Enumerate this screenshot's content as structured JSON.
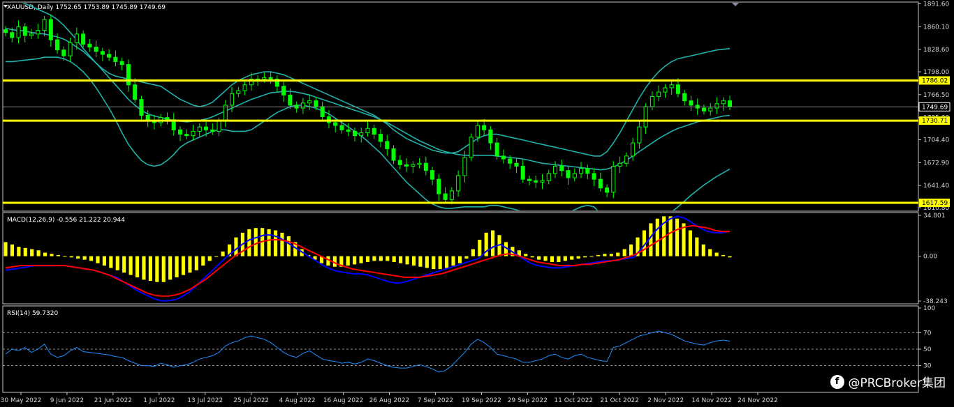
{
  "chart_data": [
    {
      "type": "candlestick",
      "symbol": "XAUUSD,,Daily",
      "ohlc": "1752.65 1753.89 1745.89 1749.69",
      "title": "XAUUSD,,Daily 1752.65 1753.89 1745.89 1749.69",
      "ylim": [
        1607,
        1893
      ],
      "y_ticks": [
        "1891.60",
        "1860.10",
        "1828.60",
        "1798.00",
        "1766.50",
        "1735.00",
        "1704.40",
        "1672.90",
        "1641.40",
        "1610.80"
      ],
      "y_tick_values": [
        1891.6,
        1860.1,
        1828.6,
        1798.0,
        1766.5,
        1735.0,
        1704.4,
        1672.9,
        1641.4,
        1610.8
      ],
      "horizontal_levels": [
        {
          "value": 1786.02,
          "label": "1786.02",
          "color": "#ffff00"
        },
        {
          "value": 1730.71,
          "label": "1730.71",
          "color": "#ffff00"
        },
        {
          "value": 1617.59,
          "label": "1617.59",
          "color": "#ffff00"
        }
      ],
      "price_line": {
        "value": 1749.69,
        "label": "1749.69"
      },
      "colors": {
        "candle": "#00ff00",
        "bollinger": "#20b2aa",
        "levels": "#ffff00"
      },
      "x_labels": [
        "30 May 2022",
        "9 Jun 2022",
        "21 Jun 2022",
        "1 Jul 2022",
        "13 Jul 2022",
        "25 Jul 2022",
        "4 Aug 2022",
        "16 Aug 2022",
        "26 Aug 2022",
        "7 Sep 2022",
        "19 Sep 2022",
        "29 Sep 2022",
        "11 Oct 2022",
        "21 Oct 2022",
        "2 Nov 2022",
        "14 Nov 2022",
        "24 Nov 2022"
      ],
      "close": [
        1852,
        1845,
        1860,
        1848,
        1850,
        1855,
        1870,
        1842,
        1828,
        1820,
        1838,
        1850,
        1836,
        1832,
        1826,
        1822,
        1818,
        1812,
        1808,
        1780,
        1760,
        1738,
        1730,
        1728,
        1735,
        1732,
        1718,
        1712,
        1710,
        1716,
        1722,
        1718,
        1716,
        1730,
        1752,
        1768,
        1772,
        1780,
        1788,
        1788,
        1790,
        1788,
        1778,
        1766,
        1752,
        1748,
        1755,
        1758,
        1750,
        1736,
        1728,
        1724,
        1718,
        1716,
        1710,
        1714,
        1720,
        1712,
        1702,
        1692,
        1676,
        1670,
        1668,
        1670,
        1672,
        1662,
        1650,
        1630,
        1622,
        1634,
        1655,
        1680,
        1708,
        1724,
        1718,
        1700,
        1682,
        1678,
        1672,
        1668,
        1650,
        1648,
        1646,
        1648,
        1658,
        1668,
        1662,
        1652,
        1658,
        1665,
        1658,
        1650,
        1638,
        1632,
        1668,
        1672,
        1682,
        1700,
        1722,
        1750,
        1764,
        1770,
        1776,
        1780,
        1768,
        1758,
        1752,
        1748,
        1744,
        1748,
        1754,
        1758,
        1750
      ],
      "bollinger": {
        "upper": [
          1905,
          1900,
          1896,
          1892,
          1888,
          1884,
          1880,
          1876,
          1870,
          1862,
          1852,
          1842,
          1830,
          1820,
          1810,
          1802,
          1796,
          1792,
          1790,
          1788,
          1786,
          1784,
          1782,
          1780,
          1778,
          1772,
          1766,
          1760,
          1756,
          1752,
          1750,
          1752,
          1756,
          1764,
          1772,
          1780,
          1786,
          1790,
          1794,
          1796,
          1798,
          1798,
          1796,
          1794,
          1790,
          1786,
          1782,
          1778,
          1774,
          1770,
          1766,
          1762,
          1758,
          1754,
          1750,
          1746,
          1742,
          1738,
          1732,
          1726,
          1718,
          1712,
          1706,
          1702,
          1698,
          1694,
          1690,
          1688,
          1686,
          1686,
          1688,
          1694,
          1700,
          1706,
          1710,
          1712,
          1712,
          1710,
          1708,
          1706,
          1704,
          1702,
          1700,
          1698,
          1696,
          1694,
          1692,
          1690,
          1688,
          1686,
          1684,
          1682,
          1682,
          1688,
          1700,
          1714,
          1730,
          1746,
          1762,
          1776,
          1788,
          1798,
          1806,
          1812,
          1816,
          1818,
          1820,
          1822,
          1824,
          1826,
          1828,
          1829,
          1830
        ],
        "middle": [
          1858,
          1856,
          1855,
          1854,
          1852,
          1851,
          1850,
          1848,
          1846,
          1843,
          1838,
          1832,
          1826,
          1818,
          1810,
          1800,
          1790,
          1780,
          1770,
          1760,
          1752,
          1745,
          1740,
          1737,
          1735,
          1733,
          1731,
          1730,
          1729,
          1730,
          1731,
          1733,
          1736,
          1740,
          1744,
          1748,
          1752,
          1756,
          1760,
          1763,
          1766,
          1769,
          1770,
          1771,
          1771,
          1770,
          1768,
          1766,
          1763,
          1760,
          1757,
          1754,
          1751,
          1748,
          1745,
          1742,
          1739,
          1736,
          1732,
          1728,
          1723,
          1718,
          1713,
          1708,
          1703,
          1699,
          1695,
          1691,
          1688,
          1686,
          1684,
          1683,
          1683,
          1683,
          1683,
          1683,
          1682,
          1681,
          1680,
          1679,
          1678,
          1676,
          1674,
          1672,
          1671,
          1670,
          1669,
          1668,
          1667,
          1666,
          1665,
          1664,
          1663,
          1664,
          1667,
          1671,
          1676,
          1682,
          1688,
          1694,
          1700,
          1706,
          1711,
          1716,
          1720,
          1723,
          1726,
          1729,
          1731,
          1733,
          1735,
          1737,
          1738
        ],
        "lower": [
          1812,
          1812,
          1813,
          1814,
          1815,
          1816,
          1818,
          1818,
          1818,
          1816,
          1812,
          1806,
          1798,
          1788,
          1776,
          1762,
          1748,
          1732,
          1714,
          1698,
          1686,
          1676,
          1670,
          1668,
          1670,
          1676,
          1684,
          1694,
          1700,
          1704,
          1708,
          1712,
          1716,
          1718,
          1718,
          1716,
          1716,
          1716,
          1718,
          1724,
          1730,
          1736,
          1742,
          1746,
          1750,
          1752,
          1752,
          1750,
          1748,
          1744,
          1740,
          1734,
          1728,
          1722,
          1716,
          1710,
          1702,
          1694,
          1686,
          1676,
          1666,
          1656,
          1646,
          1638,
          1630,
          1622,
          1616,
          1612,
          1610,
          1610,
          1611,
          1612,
          1612,
          1612,
          1612,
          1614,
          1614,
          1612,
          1610,
          1608,
          1605,
          1602,
          1600,
          1598,
          1597,
          1598,
          1600,
          1604,
          1608,
          1612,
          1614,
          1612,
          1602,
          1588,
          1574,
          1562,
          1556,
          1556,
          1560,
          1568,
          1576,
          1586,
          1596,
          1605,
          1612,
          1620,
          1628,
          1635,
          1642,
          1648,
          1654,
          1659,
          1664
        ]
      }
    },
    {
      "type": "bar+line",
      "indicator": "MACD(12,26,9) -0.556 21.222 20.944",
      "title": "MACD(12,26,9) -0.556 21.222 20.944",
      "ylim": [
        -38.243,
        34.801
      ],
      "y_ticks": [
        "34.801",
        "0.00",
        "-38.243"
      ],
      "y_tick_values": [
        34.801,
        0,
        -38.243
      ],
      "colors": {
        "histogram": "#ffff00",
        "macd": "#0000ff",
        "signal": "#ff0000"
      },
      "histogram": [
        12,
        10,
        8,
        7,
        6,
        5,
        3,
        2,
        1,
        0,
        -1,
        -2,
        -3,
        -4,
        -6,
        -8,
        -10,
        -12,
        -14,
        -16,
        -18,
        -20,
        -21,
        -22,
        -22,
        -20,
        -18,
        -16,
        -14,
        -12,
        -8,
        -4,
        0,
        4,
        10,
        16,
        20,
        23,
        24,
        24,
        23,
        22,
        20,
        17,
        12,
        6,
        1,
        -3,
        -6,
        -8,
        -9,
        -9,
        -8,
        -7,
        -6,
        -5,
        -4,
        -4,
        -4,
        -5,
        -6,
        -7,
        -8,
        -9,
        -10,
        -11,
        -11,
        -10,
        -8,
        -6,
        -2,
        6,
        14,
        20,
        22,
        18,
        12,
        8,
        5,
        2,
        -1,
        -3,
        -4,
        -5,
        -5,
        -4,
        -3,
        -2,
        -1,
        0,
        1,
        2,
        2,
        3,
        6,
        10,
        16,
        22,
        28,
        32,
        34,
        34,
        32,
        28,
        22,
        16,
        10,
        6,
        3,
        1,
        -1
      ],
      "macd": [
        -12,
        -11,
        -10,
        -9,
        -8,
        -8,
        -8,
        -8,
        -8,
        -9,
        -10,
        -11,
        -12,
        -14,
        -16,
        -18,
        -22,
        -26,
        -30,
        -33,
        -36,
        -38,
        -38,
        -37,
        -34,
        -30,
        -24,
        -18,
        -12,
        -6,
        0,
        5,
        10,
        14,
        16,
        18,
        18,
        16,
        12,
        8,
        4,
        0,
        -4,
        -8,
        -11,
        -13,
        -14,
        -15,
        -15,
        -16,
        -18,
        -20,
        -22,
        -23,
        -22,
        -20,
        -18,
        -16,
        -14,
        -12,
        -10,
        -8,
        -6,
        -4,
        -2,
        4,
        8,
        10,
        6,
        2,
        -2,
        -6,
        -8,
        -9,
        -10,
        -10,
        -9,
        -8,
        -7,
        -6,
        -5,
        -4,
        -4,
        -3,
        -2,
        -1,
        6,
        14,
        22,
        28,
        32,
        34,
        32,
        28,
        24,
        21,
        20,
        20,
        21
      ],
      "signal": [
        -10,
        -9,
        -8,
        -8,
        -8,
        -8,
        -8,
        -8,
        -8,
        -9,
        -10,
        -11,
        -12,
        -14,
        -16,
        -19,
        -22,
        -25,
        -28,
        -31,
        -33,
        -34,
        -34,
        -33,
        -31,
        -28,
        -24,
        -20,
        -15,
        -10,
        -5,
        0,
        4,
        8,
        11,
        13,
        14,
        14,
        13,
        11,
        8,
        5,
        2,
        -1,
        -4,
        -7,
        -9,
        -11,
        -12,
        -13,
        -14,
        -15,
        -16,
        -17,
        -18,
        -18,
        -18,
        -17,
        -16,
        -15,
        -13,
        -11,
        -9,
        -7,
        -5,
        -3,
        -1,
        1,
        2,
        1,
        -1,
        -3,
        -5,
        -6,
        -7,
        -8,
        -8,
        -8,
        -7,
        -7,
        -6,
        -5,
        -4,
        -3,
        -1,
        1,
        4,
        8,
        12,
        16,
        20,
        23,
        25,
        26,
        25,
        24,
        22,
        21,
        20.944
      ]
    },
    {
      "type": "line",
      "indicator": "RSI(14) 59.7320",
      "title": "RSI(14) 59.7320",
      "ylim": [
        0,
        100
      ],
      "y_ticks": [
        "100",
        "70",
        "50",
        "30"
      ],
      "y_tick_values": [
        100,
        70,
        50,
        30
      ],
      "levels": [
        70,
        50,
        30
      ],
      "colors": {
        "rsi": "#1e90ff",
        "levels": "#c0c0c0"
      },
      "rsi": [
        44,
        50,
        48,
        52,
        46,
        50,
        56,
        44,
        40,
        42,
        48,
        52,
        47,
        46,
        45,
        44,
        43,
        41,
        40,
        36,
        33,
        30,
        30,
        29,
        33,
        31,
        28,
        30,
        31,
        34,
        38,
        40,
        42,
        46,
        54,
        58,
        60,
        64,
        66,
        64,
        62,
        58,
        52,
        46,
        42,
        40,
        45,
        48,
        43,
        38,
        36,
        35,
        33,
        34,
        32,
        34,
        38,
        36,
        33,
        30,
        28,
        27,
        27,
        29,
        31,
        29,
        26,
        22,
        24,
        30,
        38,
        46,
        56,
        62,
        58,
        52,
        44,
        42,
        40,
        38,
        34,
        34,
        36,
        38,
        42,
        44,
        40,
        38,
        42,
        44,
        40,
        38,
        36,
        35,
        52,
        54,
        58,
        62,
        66,
        68,
        70,
        72,
        70,
        68,
        64,
        60,
        58,
        56,
        55,
        58,
        60,
        61,
        59.732
      ]
    }
  ],
  "branding": {
    "watermark": "@PRCBroker集团"
  }
}
